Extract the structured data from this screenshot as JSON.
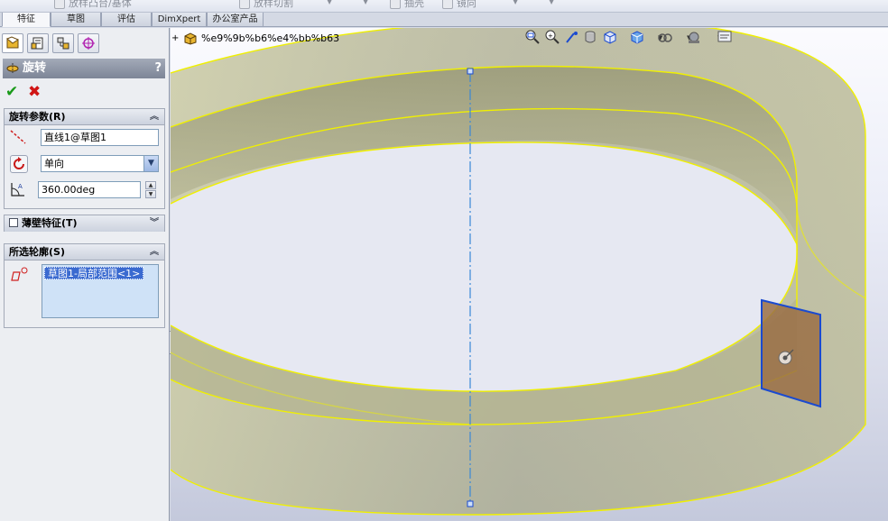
{
  "toolbar": {
    "ghost_items": [
      "放样凸台/基体",
      "放样切割",
      "抽壳",
      "镜向"
    ]
  },
  "command_tabs": [
    {
      "label": "特征",
      "active": true
    },
    {
      "label": "草图",
      "active": false
    },
    {
      "label": "评估",
      "active": false
    },
    {
      "label": "DimXpert",
      "active": false
    },
    {
      "label": "办公室产品",
      "active": false
    }
  ],
  "property_manager": {
    "title": "旋转",
    "help": "?",
    "params_group": {
      "title": "旋转参数(R)",
      "axis_value": "直线1@草图1",
      "direction_value": "单向",
      "angle_value": "360.00deg"
    },
    "thin_group": {
      "title": "薄壁特征(T)"
    },
    "contours_group": {
      "title": "所选轮廓(S)",
      "selected_item": "草图1-局部范围<1>"
    }
  },
  "feature_tree": {
    "node_label": "%e9%9b%b6%e4%bb%b63"
  },
  "colors": {
    "ring_fill": "#b9b990",
    "ring_edge": "#f0f000",
    "section_fill": "#9a6e45",
    "axis": "#3a88d8"
  },
  "heads_up_icons": [
    "zoom-to-fit-icon",
    "zoom-area-icon",
    "previous-view-icon",
    "section-view-icon",
    "view-orientation-icon",
    "display-style-icon",
    "hide-show-icon",
    "edit-appearance-icon",
    "apply-scene-icon",
    "view-settings-icon"
  ]
}
